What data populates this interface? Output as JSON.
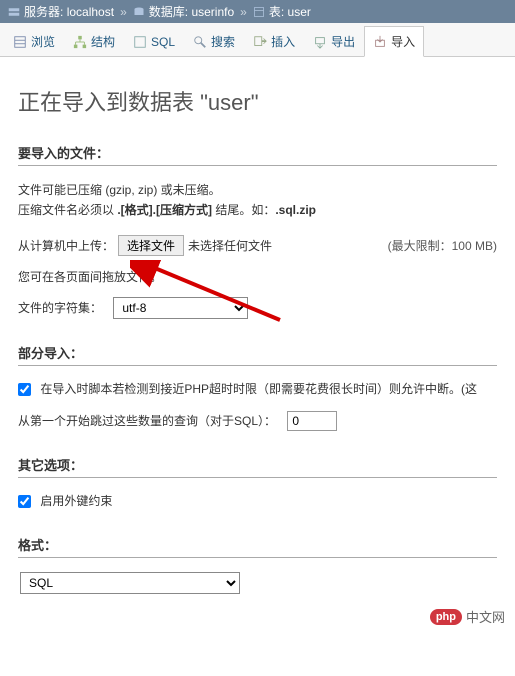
{
  "breadcrumb": {
    "server_label": "服务器:",
    "server_value": "localhost",
    "db_label": "数据库:",
    "db_value": "userinfo",
    "table_label": "表:",
    "table_value": "user"
  },
  "tabs": {
    "browse": "浏览",
    "structure": "结构",
    "sql": "SQL",
    "search": "搜索",
    "insert": "插入",
    "export": "导出",
    "import": "导入"
  },
  "title": "正在导入到数据表 \"user\"",
  "sections": {
    "file_to_import": "要导入的文件：",
    "partial_import": "部分导入：",
    "other_options": "其它选项：",
    "format": "格式："
  },
  "file": {
    "compress_hint1": "文件可能已压缩 (gzip, zip) 或未压缩。",
    "compress_hint2_a": "压缩文件名必须以 ",
    "compress_hint2_b": ".[格式].[压缩方式]",
    "compress_hint2_c": " 结尾。如：",
    "compress_hint2_d": ".sql.zip",
    "upload_label": "从计算机中上传：",
    "choose_button": "选择文件",
    "no_file": "未选择任何文件",
    "limit": "(最大限制：100 MB)",
    "drag_hint": "您可在各页面间拖放文件。",
    "charset_label": "文件的字符集：",
    "charset_value": "utf-8"
  },
  "partial": {
    "interrupt_label": "在导入时脚本若检测到接近PHP超时时限（即需要花费很长时间）则允许中断。(这",
    "interrupt_checked": true,
    "skip_label": "从第一个开始跳过这些数量的查询（对于SQL）：",
    "skip_value": "0"
  },
  "other": {
    "fk_label": "启用外键约束",
    "fk_checked": true
  },
  "format": {
    "value": "SQL"
  },
  "watermark": {
    "badge": "php",
    "text": "中文网"
  }
}
